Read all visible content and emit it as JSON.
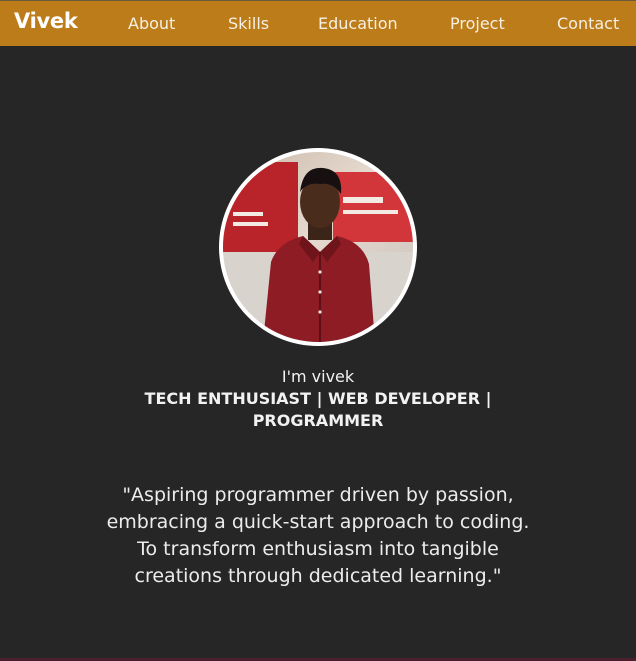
{
  "nav": {
    "brand": "Vivek",
    "links": [
      "About",
      "Skills",
      "Education",
      "Project",
      "Contact"
    ]
  },
  "hero": {
    "greeting": "I'm vivek",
    "roles": "TECH ENTHUSIAST | WEB DEVELOPER | PROGRAMMER",
    "quote_line1": "\"Aspiring programmer driven by passion, embracing a quick-start approach to coding.",
    "quote_line2": "To transform enthusiasm into tangible creations through dedicated learning.\""
  },
  "colors": {
    "nav_bg": "#bd7c1a",
    "page_bg": "#262626",
    "text": "#f2f2f2"
  }
}
